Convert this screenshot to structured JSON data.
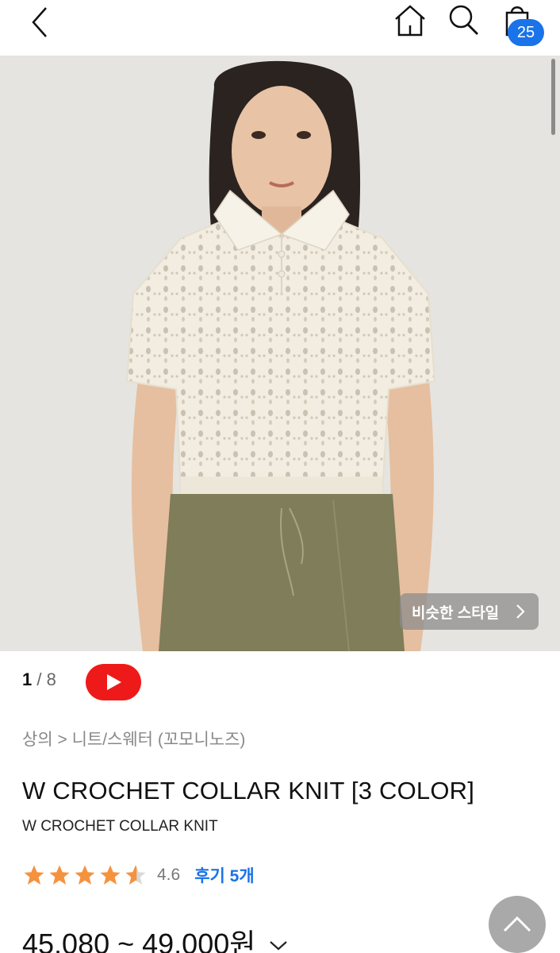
{
  "colors": {
    "accent": "#1a73e8",
    "youtube_red": "#ee1a1a",
    "star": "#f5923e"
  },
  "header": {
    "back_icon": "chevron-left-icon",
    "home_icon": "home-icon",
    "search_icon": "search-icon",
    "cart_icon": "shopping-bag-icon",
    "cart_count": "25"
  },
  "gallery": {
    "similar_style_label": "비슷한 스타일",
    "current": "1",
    "separator": "/",
    "total": "8",
    "video_icon": "play-icon"
  },
  "product": {
    "breadcrumb": "상의 > 니트/스웨터 (꼬모니노즈)",
    "title": "W CROCHET COLLAR KNIT [3 COLOR]",
    "subtitle": "W CROCHET COLLAR KNIT",
    "rating_value": 4.6,
    "rating_text": "4.6",
    "review_label": "후기 5개",
    "price": "45,080 ~ 49,000원"
  }
}
